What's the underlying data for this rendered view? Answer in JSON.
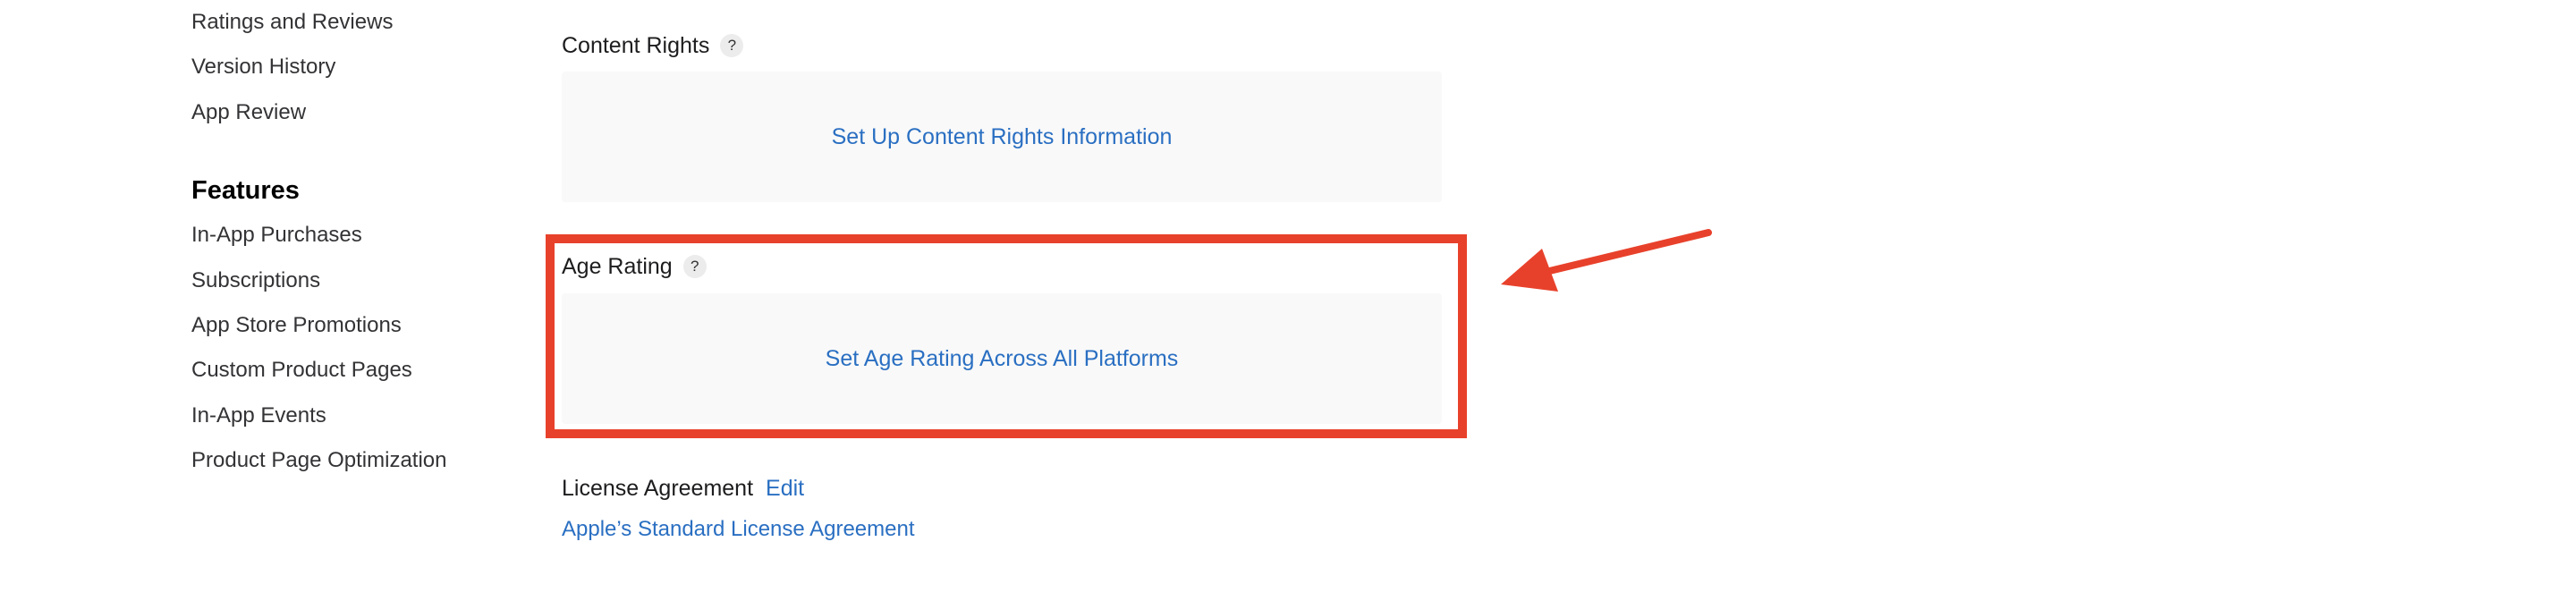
{
  "sidebar": {
    "top_items": [
      {
        "label": "Ratings and Reviews"
      },
      {
        "label": "Version History"
      },
      {
        "label": "App Review"
      }
    ],
    "features_heading": "Features",
    "feature_items": [
      {
        "label": "In-App Purchases"
      },
      {
        "label": "Subscriptions"
      },
      {
        "label": "App Store Promotions"
      },
      {
        "label": "Custom Product Pages"
      },
      {
        "label": "In-App Events"
      },
      {
        "label": "Product Page Optimization"
      }
    ]
  },
  "main": {
    "content_rights": {
      "title": "Content Rights",
      "help": "?",
      "action": "Set Up Content Rights Information"
    },
    "age_rating": {
      "title": "Age Rating",
      "help": "?",
      "action": "Set Age Rating Across All Platforms"
    },
    "license": {
      "title": "License Agreement",
      "edit": "Edit",
      "link": "Apple’s Standard License Agreement"
    }
  },
  "annotation": {
    "color": "#e8412b"
  }
}
